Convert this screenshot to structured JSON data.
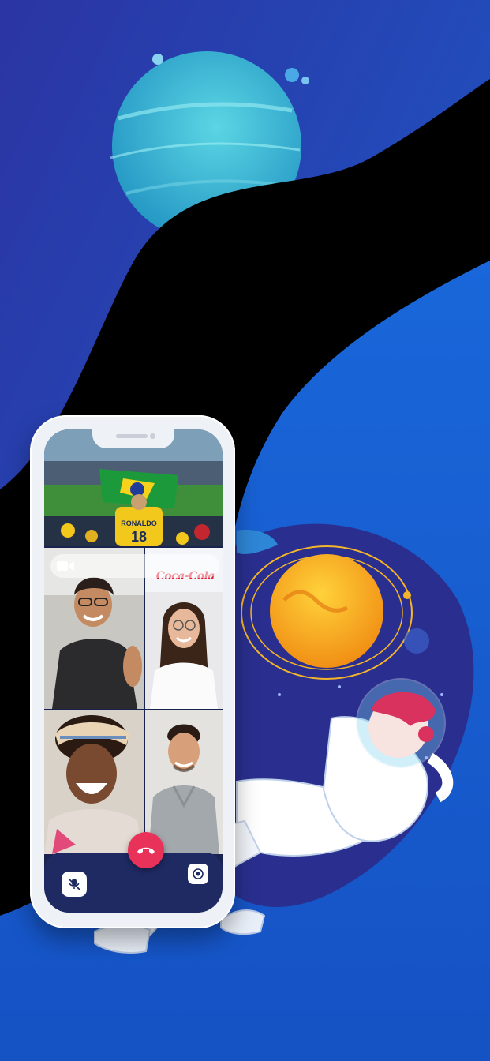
{
  "app": {
    "brand_logo_text": "Coca-Cola",
    "jersey_text": "RONALDO",
    "jersey_number": "18"
  },
  "colors": {
    "background_blue": "#1a4fc2",
    "deep_blue": "#2a36a8",
    "black_wave": "#000000",
    "end_call": "#e9325a",
    "controls_bar": "#1f2a63",
    "planet_teal": "#2ab7d1",
    "sun_orange": "#f5a81b"
  },
  "icons": {
    "camera": "video-camera-icon",
    "mute": "microphone-off-icon",
    "speaker": "speaker-toggle-icon",
    "end_call": "phone-hangup-icon"
  },
  "participants": [
    {
      "id": "stadium-fan"
    },
    {
      "id": "smiling-man"
    },
    {
      "id": "smiling-woman"
    },
    {
      "id": "laughing-lady"
    },
    {
      "id": "hoodie-guy"
    }
  ]
}
